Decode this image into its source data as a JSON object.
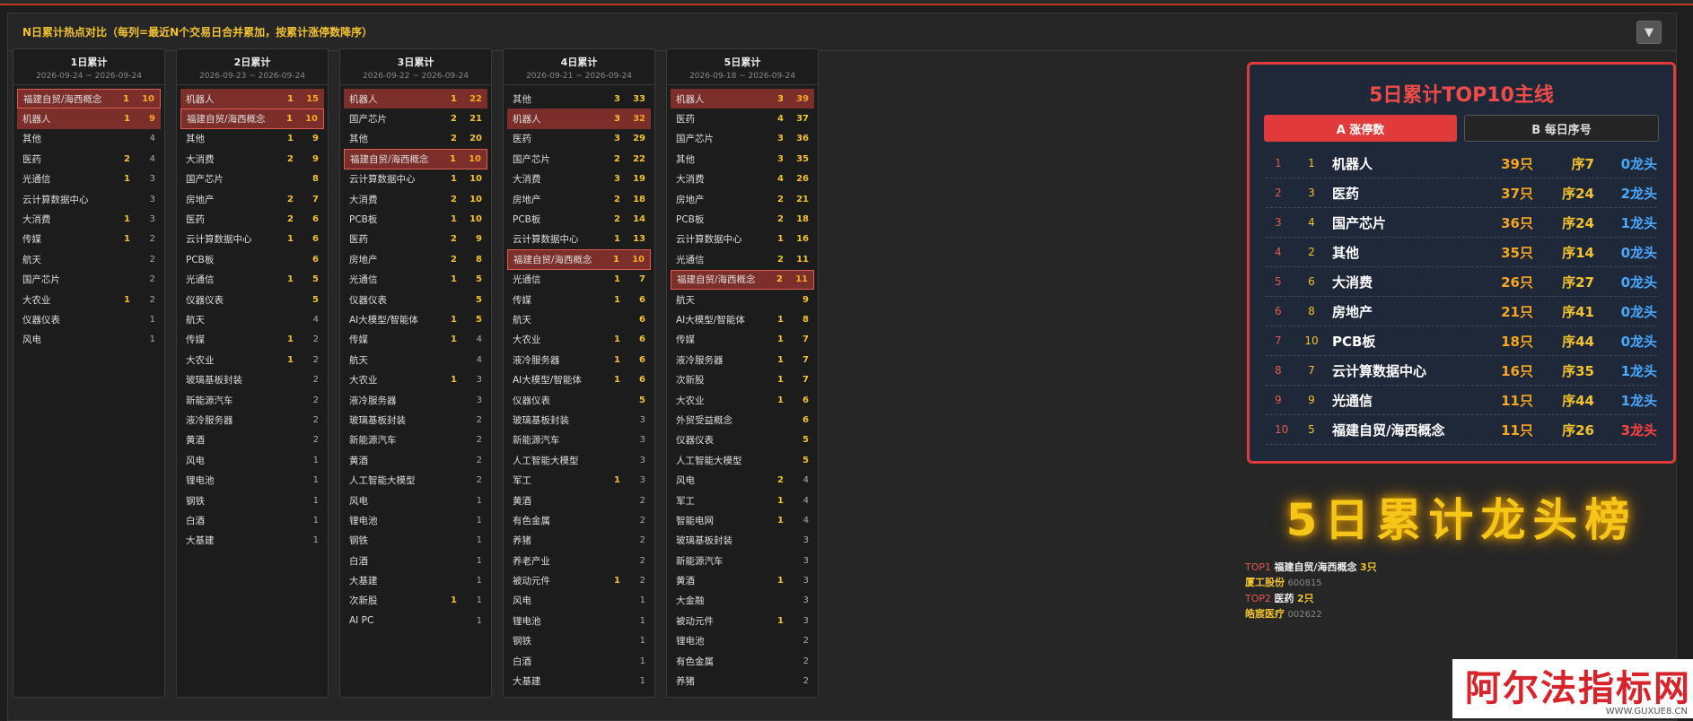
{
  "panel": {
    "title": "N日累计热点对比（每列=最近N个交易日合并累加，按累计涨停数降序）",
    "collapse_icon": "▼"
  },
  "columns": [
    {
      "title": "1日累计",
      "date": "2026-09-24 ~ 2026-09-24",
      "rows": [
        {
          "name": "福建自贸/海西概念",
          "a": "1",
          "b": "10",
          "style": "hl-box"
        },
        {
          "name": "机器人",
          "a": "1",
          "b": "9",
          "style": "hl"
        },
        {
          "name": "其他",
          "a": "",
          "b": "4"
        },
        {
          "name": "医药",
          "a": "2",
          "b": "4"
        },
        {
          "name": "光通信",
          "a": "1",
          "b": "3"
        },
        {
          "name": "云计算数据中心",
          "a": "",
          "b": "3"
        },
        {
          "name": "大消费",
          "a": "1",
          "b": "3"
        },
        {
          "name": "传媒",
          "a": "1",
          "b": "2"
        },
        {
          "name": "航天",
          "a": "",
          "b": "2"
        },
        {
          "name": "国产芯片",
          "a": "",
          "b": "2"
        },
        {
          "name": "大农业",
          "a": "1",
          "b": "2"
        },
        {
          "name": "仪器仪表",
          "a": "",
          "b": "1"
        },
        {
          "name": "风电",
          "a": "",
          "b": "1"
        }
      ]
    },
    {
      "title": "2日累计",
      "date": "2026-09-23 ~ 2026-09-24",
      "rows": [
        {
          "name": "机器人",
          "a": "1",
          "b": "15",
          "style": "hl"
        },
        {
          "name": "福建自贸/海西概念",
          "a": "1",
          "b": "10",
          "style": "hl-box"
        },
        {
          "name": "其他",
          "a": "1",
          "b": "9"
        },
        {
          "name": "大消费",
          "a": "2",
          "b": "9"
        },
        {
          "name": "国产芯片",
          "a": "",
          "b": "8"
        },
        {
          "name": "房地产",
          "a": "2",
          "b": "7"
        },
        {
          "name": "医药",
          "a": "2",
          "b": "6"
        },
        {
          "name": "云计算数据中心",
          "a": "1",
          "b": "6"
        },
        {
          "name": "PCB板",
          "a": "",
          "b": "6"
        },
        {
          "name": "光通信",
          "a": "1",
          "b": "5"
        },
        {
          "name": "仪器仪表",
          "a": "",
          "b": "5"
        },
        {
          "name": "航天",
          "a": "",
          "b": "4"
        },
        {
          "name": "传媒",
          "a": "1",
          "b": "2"
        },
        {
          "name": "大农业",
          "a": "1",
          "b": "2"
        },
        {
          "name": "玻璃基板封装",
          "a": "",
          "b": "2"
        },
        {
          "name": "新能源汽车",
          "a": "",
          "b": "2"
        },
        {
          "name": "液冷服务器",
          "a": "",
          "b": "2"
        },
        {
          "name": "黄酒",
          "a": "",
          "b": "2"
        },
        {
          "name": "风电",
          "a": "",
          "b": "1"
        },
        {
          "name": "锂电池",
          "a": "",
          "b": "1"
        },
        {
          "name": "钢铁",
          "a": "",
          "b": "1"
        },
        {
          "name": "白酒",
          "a": "",
          "b": "1"
        },
        {
          "name": "大基建",
          "a": "",
          "b": "1"
        }
      ]
    },
    {
      "title": "3日累计",
      "date": "2026-09-22 ~ 2026-09-24",
      "rows": [
        {
          "name": "机器人",
          "a": "1",
          "b": "22",
          "style": "hl"
        },
        {
          "name": "国产芯片",
          "a": "2",
          "b": "21"
        },
        {
          "name": "其他",
          "a": "2",
          "b": "20"
        },
        {
          "name": "福建自贸/海西概念",
          "a": "1",
          "b": "10",
          "style": "hl-box"
        },
        {
          "name": "云计算数据中心",
          "a": "1",
          "b": "10"
        },
        {
          "name": "大消费",
          "a": "2",
          "b": "10"
        },
        {
          "name": "PCB板",
          "a": "1",
          "b": "10"
        },
        {
          "name": "医药",
          "a": "2",
          "b": "9"
        },
        {
          "name": "房地产",
          "a": "2",
          "b": "8"
        },
        {
          "name": "光通信",
          "a": "1",
          "b": "5"
        },
        {
          "name": "仪器仪表",
          "a": "",
          "b": "5"
        },
        {
          "name": "AI大模型/智能体",
          "a": "1",
          "b": "5"
        },
        {
          "name": "传媒",
          "a": "1",
          "b": "4"
        },
        {
          "name": "航天",
          "a": "",
          "b": "4"
        },
        {
          "name": "大农业",
          "a": "1",
          "b": "3"
        },
        {
          "name": "液冷服务器",
          "a": "",
          "b": "3"
        },
        {
          "name": "玻璃基板封装",
          "a": "",
          "b": "2"
        },
        {
          "name": "新能源汽车",
          "a": "",
          "b": "2"
        },
        {
          "name": "黄酒",
          "a": "",
          "b": "2"
        },
        {
          "name": "人工智能大模型",
          "a": "",
          "b": "2"
        },
        {
          "name": "风电",
          "a": "",
          "b": "1"
        },
        {
          "name": "锂电池",
          "a": "",
          "b": "1"
        },
        {
          "name": "钢铁",
          "a": "",
          "b": "1"
        },
        {
          "name": "白酒",
          "a": "",
          "b": "1"
        },
        {
          "name": "大基建",
          "a": "",
          "b": "1"
        },
        {
          "name": "次新股",
          "a": "1",
          "b": "1"
        },
        {
          "name": "AI PC",
          "a": "",
          "b": "1"
        }
      ]
    },
    {
      "title": "4日累计",
      "date": "2026-09-21 ~ 2026-09-24",
      "rows": [
        {
          "name": "其他",
          "a": "3",
          "b": "33"
        },
        {
          "name": "机器人",
          "a": "3",
          "b": "32",
          "style": "hl"
        },
        {
          "name": "医药",
          "a": "3",
          "b": "29"
        },
        {
          "name": "国产芯片",
          "a": "2",
          "b": "22"
        },
        {
          "name": "大消费",
          "a": "3",
          "b": "19"
        },
        {
          "name": "房地产",
          "a": "2",
          "b": "18"
        },
        {
          "name": "PCB板",
          "a": "2",
          "b": "14"
        },
        {
          "name": "云计算数据中心",
          "a": "1",
          "b": "13"
        },
        {
          "name": "福建自贸/海西概念",
          "a": "1",
          "b": "10",
          "style": "hl-box"
        },
        {
          "name": "光通信",
          "a": "1",
          "b": "7"
        },
        {
          "name": "传媒",
          "a": "1",
          "b": "6"
        },
        {
          "name": "航天",
          "a": "",
          "b": "6"
        },
        {
          "name": "大农业",
          "a": "1",
          "b": "6"
        },
        {
          "name": "液冷服务器",
          "a": "1",
          "b": "6"
        },
        {
          "name": "AI大模型/智能体",
          "a": "1",
          "b": "6"
        },
        {
          "name": "仪器仪表",
          "a": "",
          "b": "5"
        },
        {
          "name": "玻璃基板封装",
          "a": "",
          "b": "3"
        },
        {
          "name": "新能源汽车",
          "a": "",
          "b": "3"
        },
        {
          "name": "人工智能大模型",
          "a": "",
          "b": "3"
        },
        {
          "name": "军工",
          "a": "1",
          "b": "3"
        },
        {
          "name": "黄酒",
          "a": "",
          "b": "2"
        },
        {
          "name": "有色金属",
          "a": "",
          "b": "2"
        },
        {
          "name": "养猪",
          "a": "",
          "b": "2"
        },
        {
          "name": "养老产业",
          "a": "",
          "b": "2"
        },
        {
          "name": "被动元件",
          "a": "1",
          "b": "2"
        },
        {
          "name": "风电",
          "a": "",
          "b": "1"
        },
        {
          "name": "锂电池",
          "a": "",
          "b": "1"
        },
        {
          "name": "钢铁",
          "a": "",
          "b": "1"
        },
        {
          "name": "白酒",
          "a": "",
          "b": "1"
        },
        {
          "name": "大基建",
          "a": "",
          "b": "1"
        }
      ]
    },
    {
      "title": "5日累计",
      "date": "2026-09-18 ~ 2026-09-24",
      "rows": [
        {
          "name": "机器人",
          "a": "3",
          "b": "39",
          "style": "hl"
        },
        {
          "name": "医药",
          "a": "4",
          "b": "37"
        },
        {
          "name": "国产芯片",
          "a": "3",
          "b": "36"
        },
        {
          "name": "其他",
          "a": "3",
          "b": "35"
        },
        {
          "name": "大消费",
          "a": "4",
          "b": "26"
        },
        {
          "name": "房地产",
          "a": "2",
          "b": "21"
        },
        {
          "name": "PCB板",
          "a": "2",
          "b": "18"
        },
        {
          "name": "云计算数据中心",
          "a": "1",
          "b": "16"
        },
        {
          "name": "光通信",
          "a": "2",
          "b": "11"
        },
        {
          "name": "福建自贸/海西概念",
          "a": "2",
          "b": "11",
          "style": "hl-box"
        },
        {
          "name": "航天",
          "a": "",
          "b": "9"
        },
        {
          "name": "AI大模型/智能体",
          "a": "1",
          "b": "8"
        },
        {
          "name": "传媒",
          "a": "1",
          "b": "7"
        },
        {
          "name": "液冷服务器",
          "a": "1",
          "b": "7"
        },
        {
          "name": "次新股",
          "a": "1",
          "b": "7"
        },
        {
          "name": "大农业",
          "a": "1",
          "b": "6"
        },
        {
          "name": "外贸受益概念",
          "a": "",
          "b": "6"
        },
        {
          "name": "仪器仪表",
          "a": "",
          "b": "5"
        },
        {
          "name": "人工智能大模型",
          "a": "",
          "b": "5"
        },
        {
          "name": "风电",
          "a": "2",
          "b": "4"
        },
        {
          "name": "军工",
          "a": "1",
          "b": "4"
        },
        {
          "name": "智能电网",
          "a": "1",
          "b": "4"
        },
        {
          "name": "玻璃基板封装",
          "a": "",
          "b": "3"
        },
        {
          "name": "新能源汽车",
          "a": "",
          "b": "3"
        },
        {
          "name": "黄酒",
          "a": "1",
          "b": "3"
        },
        {
          "name": "大金融",
          "a": "",
          "b": "3"
        },
        {
          "name": "被动元件",
          "a": "1",
          "b": "3"
        },
        {
          "name": "锂电池",
          "a": "",
          "b": "2"
        },
        {
          "name": "有色金属",
          "a": "",
          "b": "2"
        },
        {
          "name": "养猪",
          "a": "",
          "b": "2"
        }
      ]
    }
  ],
  "top10": {
    "title": "5日累计TOP10主线",
    "tab_a": "A 涨停数",
    "tab_b": "B 每日序号",
    "rows": [
      {
        "rank": "1",
        "seq": "1",
        "name": "机器人",
        "count": "39只",
        "order": "序7",
        "leader": "0龙头",
        "leader_hot": false
      },
      {
        "rank": "2",
        "seq": "3",
        "name": "医药",
        "count": "37只",
        "order": "序24",
        "leader": "2龙头",
        "leader_hot": false
      },
      {
        "rank": "3",
        "seq": "4",
        "name": "国产芯片",
        "count": "36只",
        "order": "序24",
        "leader": "1龙头",
        "leader_hot": false
      },
      {
        "rank": "4",
        "seq": "2",
        "name": "其他",
        "count": "35只",
        "order": "序14",
        "leader": "0龙头",
        "leader_hot": false
      },
      {
        "rank": "5",
        "seq": "6",
        "name": "大消费",
        "count": "26只",
        "order": "序27",
        "leader": "0龙头",
        "leader_hot": false
      },
      {
        "rank": "6",
        "seq": "8",
        "name": "房地产",
        "count": "21只",
        "order": "序41",
        "leader": "0龙头",
        "leader_hot": false
      },
      {
        "rank": "7",
        "seq": "10",
        "name": "PCB板",
        "count": "18只",
        "order": "序44",
        "leader": "0龙头",
        "leader_hot": false
      },
      {
        "rank": "8",
        "seq": "7",
        "name": "云计算数据中心",
        "count": "16只",
        "order": "序35",
        "leader": "1龙头",
        "leader_hot": false
      },
      {
        "rank": "9",
        "seq": "9",
        "name": "光通信",
        "count": "11只",
        "order": "序44",
        "leader": "1龙头",
        "leader_hot": false
      },
      {
        "rank": "10",
        "seq": "5",
        "name": "福建自贸/海西概念",
        "count": "11只",
        "order": "序26",
        "leader": "3龙头",
        "leader_hot": true
      }
    ]
  },
  "dragon": {
    "title": "5日累计龙头榜",
    "items": [
      {
        "top": "TOP1",
        "topic": "福建自贸/海西概念",
        "count": "3只",
        "stock": "厦工股份",
        "code": "600815"
      },
      {
        "top": "TOP2",
        "topic": "医药",
        "count": "2只",
        "stock": "皓宸医疗",
        "code": "002622"
      }
    ]
  },
  "watermark": {
    "text": "阿尔法指标网",
    "url": "WWW.GUXUE8.CN"
  }
}
